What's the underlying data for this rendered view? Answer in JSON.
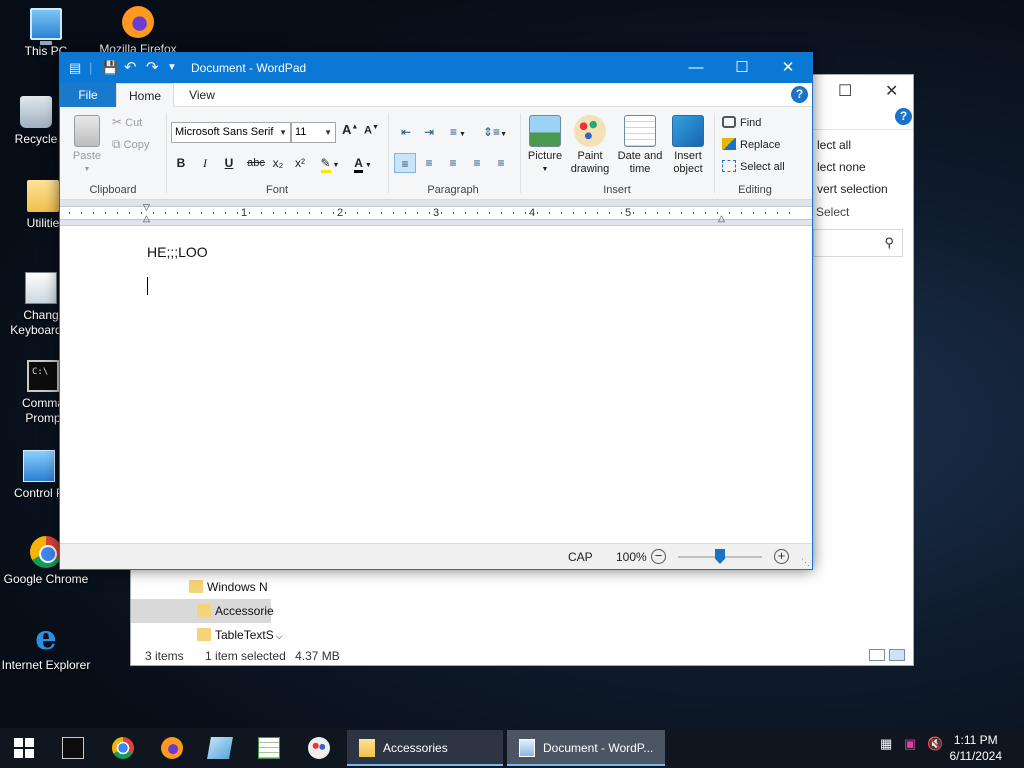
{
  "desktop": {
    "icons": [
      {
        "label": "This PC",
        "icon": "computer-icon"
      },
      {
        "label": "Mozilla Firefox",
        "icon": "firefox-icon"
      },
      {
        "label": "Recycle",
        "icon": "recycle-bin-icon"
      },
      {
        "label": "Utilitie",
        "icon": "folder-icon"
      },
      {
        "label": "Chang",
        "label2": "Keyboard L",
        "icon": "keyboard-settings-icon"
      },
      {
        "label": "Comma",
        "label2": "Promp",
        "icon": "command-prompt-icon"
      },
      {
        "label": "Control P",
        "icon": "control-panel-icon"
      },
      {
        "label": "Google Chrome",
        "icon": "chrome-icon"
      },
      {
        "label": "Internet Explorer",
        "icon": "internet-explorer-icon"
      }
    ]
  },
  "explorer": {
    "ribbon_items": [
      "lect all",
      "lect none",
      "vert selection"
    ],
    "ribbon_group": "Select",
    "tree": [
      "Windows N",
      "Accessorie",
      "TableTextS"
    ],
    "status": {
      "items": "3 items",
      "selected": "1 item selected",
      "size": "4.37 MB"
    }
  },
  "wordpad": {
    "title": "Document - WordPad",
    "tabs": {
      "file": "File",
      "home": "Home",
      "view": "View"
    },
    "help": "?",
    "clipboard": {
      "paste": "Paste",
      "cut": "Cut",
      "copy": "Copy",
      "group": "Clipboard"
    },
    "font": {
      "family": "Microsoft Sans Serif",
      "size": "11",
      "group": "Font",
      "bold": "B",
      "italic": "I",
      "underline": "U",
      "strike": "abc",
      "sub": "x₂",
      "sup": "x²",
      "color": "A"
    },
    "paragraph": {
      "group": "Paragraph"
    },
    "insert": {
      "picture": "Picture",
      "paint_1": "Paint",
      "paint_2": "drawing",
      "date_1": "Date and",
      "date_2": "time",
      "object_1": "Insert",
      "object_2": "object",
      "group": "Insert"
    },
    "editing": {
      "find": "Find",
      "replace": "Replace",
      "select_all": "Select all",
      "group": "Editing"
    },
    "ruler": [
      "1",
      "2",
      "3",
      "4",
      "5"
    ],
    "document_text": "HE;;;LOO",
    "status": {
      "caps": "CAP",
      "zoom": "100%",
      "zoom_level": 0.5
    }
  },
  "taskbar": {
    "tasks": [
      {
        "label": "Accessories",
        "icon": "folder-icon"
      },
      {
        "label": "Document - WordP...",
        "icon": "wordpad-icon"
      }
    ],
    "clock": {
      "time": "1:11 PM",
      "date": "6/11/2024"
    }
  },
  "colors": {
    "title_bar": "#0a78d4",
    "file_tab": "#1979ca",
    "taskbar": "#0f1620"
  }
}
